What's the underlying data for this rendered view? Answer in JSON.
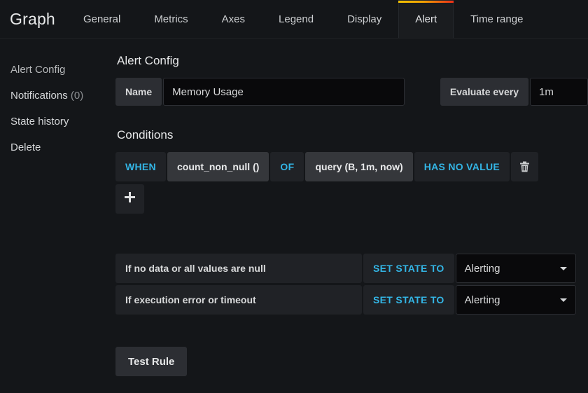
{
  "header": {
    "panel_title": "Graph",
    "tabs": [
      {
        "label": "General",
        "active": false
      },
      {
        "label": "Metrics",
        "active": false
      },
      {
        "label": "Axes",
        "active": false
      },
      {
        "label": "Legend",
        "active": false
      },
      {
        "label": "Display",
        "active": false
      },
      {
        "label": "Alert",
        "active": true
      },
      {
        "label": "Time range",
        "active": false
      }
    ]
  },
  "sidebar": {
    "items": [
      {
        "label": "Alert Config",
        "count": ""
      },
      {
        "label": "Notifications",
        "count": "(0)"
      },
      {
        "label": "State history",
        "count": ""
      },
      {
        "label": "Delete",
        "count": ""
      }
    ]
  },
  "alert_config": {
    "title": "Alert Config",
    "name_label": "Name",
    "name_value": "Memory Usage",
    "evaluate_label": "Evaluate every",
    "evaluate_value": "1m"
  },
  "conditions": {
    "title": "Conditions",
    "rows": [
      {
        "when": "WHEN",
        "reducer": "count_non_null ()",
        "of": "OF",
        "query": "query (B, 1m, now)",
        "evaluator": "HAS NO VALUE",
        "delete_icon": "trash-icon"
      }
    ],
    "add_icon": "plus-icon"
  },
  "state_handling": {
    "rows": [
      {
        "description": "If no data or all values are null",
        "set_state_label": "SET STATE TO",
        "state_value": "Alerting",
        "caret_icon": "chevron-down-icon"
      },
      {
        "description": "If execution error or timeout",
        "set_state_label": "SET STATE TO",
        "state_value": "Alerting",
        "caret_icon": "chevron-down-icon"
      }
    ]
  },
  "actions": {
    "test_rule_label": "Test Rule"
  },
  "colors": {
    "accent_blue": "#33b5e5",
    "tab_gradient_start": "#f2c200",
    "tab_gradient_end": "#ed2e18",
    "page_bg": "#141619",
    "panel_bg": "#202226",
    "input_bg": "#09090b"
  }
}
